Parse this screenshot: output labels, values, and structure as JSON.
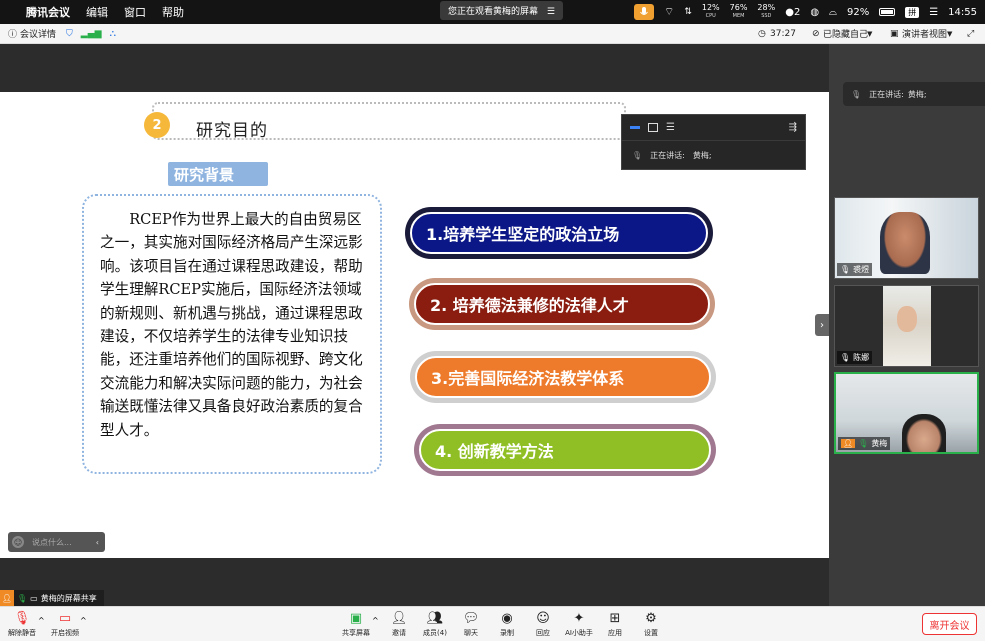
{
  "menubar": {
    "app_name": "腾讯会议",
    "items": [
      "编辑",
      "窗口",
      "帮助"
    ],
    "cpu_value": "12%",
    "cpu_label": "CPU",
    "mem_value": "76%",
    "mem_label": "MEM",
    "ssd_value": "28%",
    "ssd_label": "SSD",
    "notif_count": "2",
    "battery": "92%",
    "input_method": "拼",
    "clock": "14:55"
  },
  "toolbar": {
    "meeting_info": "会议详情",
    "viewing_notice": "您正在观看黄梅的屏幕",
    "duration": "37:27",
    "hide_self": "已隐藏自己",
    "view_mode": "演讲者视图"
  },
  "slide": {
    "number": "2",
    "title": "研究目的",
    "background_tag": "研究背景",
    "paragraph": "RCEP作为世界上最大的自由贸易区之一，其实施对国际经济格局产生深远影响。该项目旨在通过课程思政建设，帮助学生理解RCEP实施后，国际经济法领域的新规则、新机遇与挑战，通过课程思政建设，不仅培养学生的法律专业知识技能，还注重培养他们的国际视野、跨文化交流能力和解决实际问题的能力，为社会输送既懂法律又具备良好政治素质的复合型人才。",
    "goals": [
      {
        "label": "1.培养学生坚定的政治立场",
        "color": "#0b1786",
        "ring": "#1a1a3a"
      },
      {
        "label": "2. 培养德法兼修的法律人才",
        "color": "#8a1d0f",
        "ring": "#c89880"
      },
      {
        "label": "3.完善国际经济法教学体系",
        "color": "#ee7a2c",
        "ring": "#cfcfcf"
      },
      {
        "label": "4. 创新教学方法",
        "color": "#8fbf24",
        "ring": "#a07890"
      }
    ]
  },
  "float_panel": {
    "speaking_label": "正在讲话:",
    "speaker": "黄梅;"
  },
  "sidebar": {
    "speaking_label": "正在讲话:",
    "speaker": "黄梅;",
    "participants": [
      {
        "name": "裘煜"
      },
      {
        "name": "陈娜"
      },
      {
        "name": "黄梅"
      }
    ]
  },
  "comment": {
    "placeholder": "说点什么..."
  },
  "share_label": "黄梅的屏幕共享",
  "bottombar": {
    "items": [
      {
        "label": "解除静音"
      },
      {
        "label": "开启视频"
      },
      {
        "label": "共享屏幕"
      },
      {
        "label": "邀请"
      },
      {
        "label": "成员(4)"
      },
      {
        "label": "聊天"
      },
      {
        "label": "录制"
      },
      {
        "label": "回应"
      },
      {
        "label": "AI小助手"
      },
      {
        "label": "应用"
      },
      {
        "label": "设置"
      }
    ],
    "leave": "离开会议"
  }
}
